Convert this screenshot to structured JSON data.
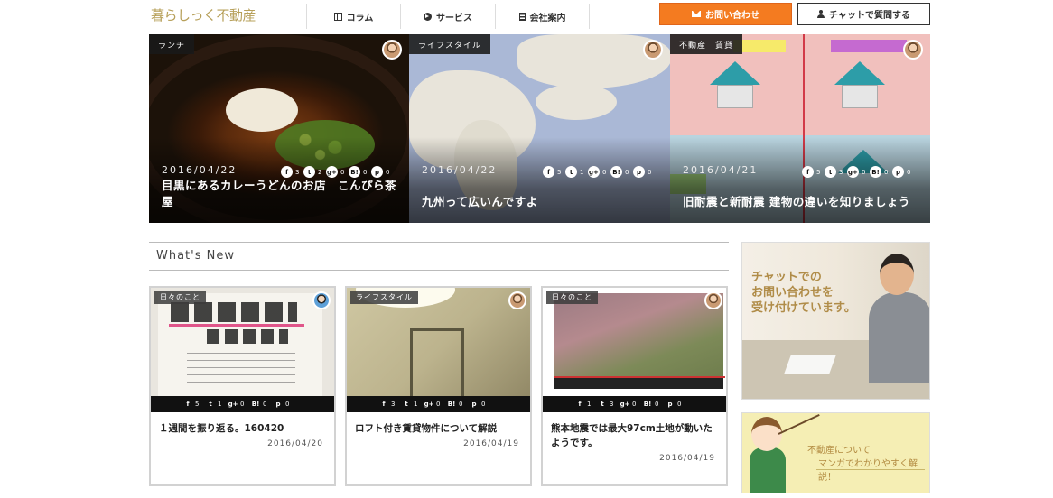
{
  "header": {
    "logo": "暮らしっく不動産",
    "nav": [
      {
        "label": "コラム",
        "icon": "columns-icon"
      },
      {
        "label": "サービス",
        "icon": "chevron-circle-icon"
      },
      {
        "label": "会社案内",
        "icon": "building-icon"
      }
    ],
    "contact_button": "お問い合わせ",
    "chat_button": "チャットで質問する",
    "accent_color": "#f47b20"
  },
  "hero": [
    {
      "category": "ランチ",
      "date": "2016/04/22",
      "title": "目黒にあるカレーうどんのお店　こんぴら茶屋",
      "social": [
        {
          "icon": "f",
          "count": "3"
        },
        {
          "icon": "t",
          "count": "2"
        },
        {
          "icon": "g+",
          "count": "0"
        },
        {
          "icon": "B!",
          "count": "0"
        },
        {
          "icon": "p",
          "count": "0"
        }
      ]
    },
    {
      "category": "ライフスタイル",
      "date": "2016/04/22",
      "title": "九州って広いんですよ",
      "social": [
        {
          "icon": "f",
          "count": "5"
        },
        {
          "icon": "t",
          "count": "1"
        },
        {
          "icon": "g+",
          "count": "0"
        },
        {
          "icon": "B!",
          "count": "0"
        },
        {
          "icon": "p",
          "count": "0"
        }
      ]
    },
    {
      "category": "不動産　賃貸",
      "date": "2016/04/21",
      "title": "旧耐震と新耐震 建物の違いを知りましょう",
      "social": [
        {
          "icon": "f",
          "count": "5"
        },
        {
          "icon": "t",
          "count": "3"
        },
        {
          "icon": "g+",
          "count": "0"
        },
        {
          "icon": "B!",
          "count": "0"
        },
        {
          "icon": "p",
          "count": "0"
        }
      ]
    }
  ],
  "whats_new": {
    "heading": "What's New",
    "cards": [
      {
        "category": "日々のこと",
        "title": "１週間を振り返る。160420",
        "date": "2016/04/20",
        "social": [
          {
            "icon": "f",
            "count": "5"
          },
          {
            "icon": "t",
            "count": "1"
          },
          {
            "icon": "g+",
            "count": "0"
          },
          {
            "icon": "B!",
            "count": "0"
          },
          {
            "icon": "p",
            "count": "0"
          }
        ]
      },
      {
        "category": "ライフスタイル",
        "title": "ロフト付き賃貸物件について解説",
        "date": "2016/04/19",
        "social": [
          {
            "icon": "f",
            "count": "3"
          },
          {
            "icon": "t",
            "count": "1"
          },
          {
            "icon": "g+",
            "count": "0"
          },
          {
            "icon": "B!",
            "count": "0"
          },
          {
            "icon": "p",
            "count": "0"
          }
        ]
      },
      {
        "category": "日々のこと",
        "title": "熊本地震では最大97cm土地が動いたようです。",
        "date": "2016/04/19",
        "social": [
          {
            "icon": "f",
            "count": "1"
          },
          {
            "icon": "t",
            "count": "3"
          },
          {
            "icon": "g+",
            "count": "0"
          },
          {
            "icon": "B!",
            "count": "0"
          },
          {
            "icon": "p",
            "count": "0"
          }
        ]
      }
    ]
  },
  "sidebar": {
    "chat_banner_lines": [
      "チャットでの",
      "お問い合わせを",
      "受け付けています。"
    ],
    "manga_banner_lines": [
      "不動産について",
      "マンガでわかりやすく解説！"
    ]
  }
}
